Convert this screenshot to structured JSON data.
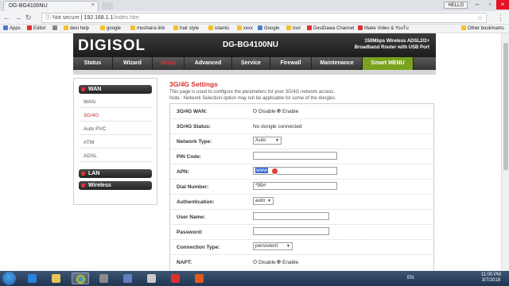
{
  "browser": {
    "tab_title": "DG-BG4100NU",
    "tab_close": "×",
    "profile_label": "HELLO",
    "security_label": "ⓘ Not secure",
    "url_host": "192.168.1.1",
    "url_path": "/index.htm",
    "bookmarks": [
      {
        "label": "Apps",
        "color": "#4a7fd4"
      },
      {
        "label": "Editor",
        "color": "#e0322e"
      },
      {
        "label": "",
        "color": "#888888"
      },
      {
        "label": "desi help",
        "color": "#f2c12e"
      },
      {
        "label": "google",
        "color": "#f2c12e"
      },
      {
        "label": "mushaira link",
        "color": "#f2c12e"
      },
      {
        "label": "hair style",
        "color": "#f2c12e"
      },
      {
        "label": "islamic",
        "color": "#f2c12e"
      },
      {
        "label": "xxxx",
        "color": "#f2c12e"
      },
      {
        "label": "Google",
        "color": "#4a7fd4"
      },
      {
        "label": "tool",
        "color": "#f2c12e"
      },
      {
        "label": "DesiDawa Channel",
        "color": "#e0322e"
      },
      {
        "label": "Make Video & YouTu",
        "color": "#e0322e"
      },
      {
        "label": "Other bookmarks",
        "color": "#f2c12e"
      }
    ]
  },
  "router": {
    "logo": "DIGISOL",
    "model": "DG-BG4100NU",
    "tagline_line1": "150Mbps Wireless ADSL2/2+",
    "tagline_line2": "Broadband Router with USB Port",
    "nav": [
      "Status",
      "Wizard",
      "Setup",
      "Advanced",
      "Service",
      "Firewall",
      "Maintenance",
      "Smart MENU"
    ],
    "active_nav": "Setup",
    "sidebar": {
      "wan_group": "WAN",
      "wan_items": [
        "WAN",
        "3G/4G",
        "Auto PVC",
        "ATM",
        "ADSL"
      ],
      "active_item": "3G/4G",
      "lan_group": "LAN",
      "wireless_group": "Wireless"
    },
    "content": {
      "title": "3G/4G Settings",
      "desc_line1": "This page is used to configure the parameters for your 3G/4G network access.",
      "desc_line2": "Note : Network Selection option may not be applicable for some of the dongles"
    },
    "form": {
      "wan_label": "3G/4G WAN:",
      "wan_disable": "Disable",
      "wan_enable": "Enable",
      "wan_value": "Enable",
      "status_label": "3G/4G Status:",
      "status_value": "No dongle connected",
      "network_type_label": "Network Type:",
      "network_type_value": "Auto",
      "pin_label": "PIN Code:",
      "pin_value": "",
      "apn_label": "APN:",
      "apn_value": "www",
      "dial_label": "Dial Number:",
      "dial_value": "*99#",
      "auth_label": "Authentication:",
      "auth_value": "auto",
      "user_label": "User Name:",
      "user_value": "",
      "password_label": "Password:",
      "password_value": "",
      "conn_type_label": "Connection Type:",
      "conn_type_value": "persistent",
      "napt_label": "NAPT:",
      "napt_disable": "Disable",
      "napt_enable": "Enable",
      "napt_value": "Enable"
    }
  },
  "taskbar": {
    "lang": "EN",
    "time": "11:00 PM",
    "date": "3/7/2018"
  }
}
